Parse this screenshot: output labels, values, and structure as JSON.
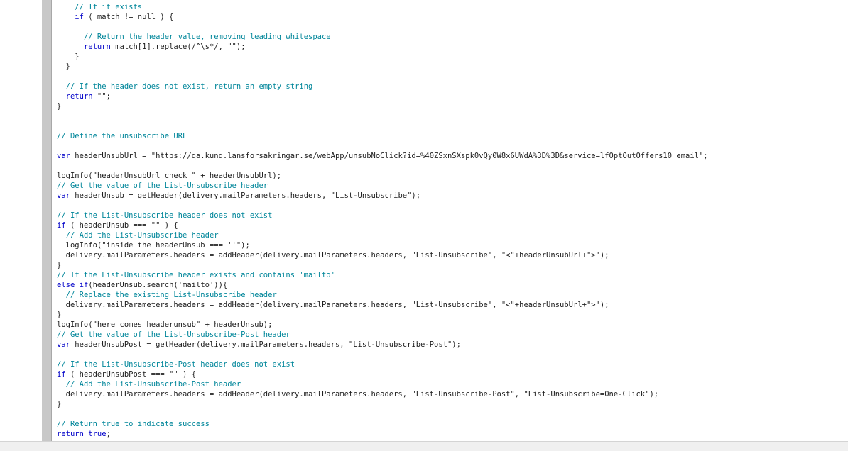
{
  "editor": {
    "lines": [
      "    // If it exists",
      "    if ( match != null ) {",
      "",
      "      // Return the header value, removing leading whitespace",
      "      return match[1].replace(/^\\s*/, \"\");",
      "    }",
      "  }",
      "",
      "  // If the header does not exist, return an empty string",
      "  return \"\";",
      "}",
      "",
      "",
      "// Define the unsubscribe URL",
      "",
      "var headerUnsubUrl = \"https://qa.kund.lansforsakringar.se/webApp/unsubNoClick?id=%40ZSxnSXspk0vQy0W8x6UWdA%3D%3D&service=lfOptOutOffers10_email\";",
      "",
      "logInfo(\"headerUnsubUrl check \" + headerUnsubUrl);",
      "// Get the value of the List-Unsubscribe header",
      "var headerUnsub = getHeader(delivery.mailParameters.headers, \"List-Unsubscribe\");",
      "",
      "// If the List-Unsubscribe header does not exist",
      "if ( headerUnsub === \"\" ) {",
      "  // Add the List-Unsubscribe header",
      "  logInfo(\"inside the headerUnsub === ''\");",
      "  delivery.mailParameters.headers = addHeader(delivery.mailParameters.headers, \"List-Unsubscribe\", \"<\"+headerUnsubUrl+\">\");",
      "}",
      "// If the List-Unsubscribe header exists and contains 'mailto'",
      "else if(headerUnsub.search('mailto')){",
      "  // Replace the existing List-Unsubscribe header",
      "  delivery.mailParameters.headers = addHeader(delivery.mailParameters.headers, \"List-Unsubscribe\", \"<\"+headerUnsubUrl+\">\");",
      "}",
      "logInfo(\"here comes headerunsub\" + headerUnsub);",
      "// Get the value of the List-Unsubscribe-Post header",
      "var headerUnsubPost = getHeader(delivery.mailParameters.headers, \"List-Unsubscribe-Post\");",
      "",
      "// If the List-Unsubscribe-Post header does not exist",
      "if ( headerUnsubPost === \"\" ) {",
      "  // Add the List-Unsubscribe-Post header",
      "  delivery.mailParameters.headers = addHeader(delivery.mailParameters.headers, \"List-Unsubscribe-Post\", \"List-Unsubscribe=One-Click\");",
      "}",
      "",
      "// Return true to indicate success",
      "return true;"
    ],
    "colors": {
      "comment": "#00869a",
      "keyword": "#0000c8",
      "text": "#1e1e1e",
      "gutter": "#c8c8c8"
    }
  }
}
